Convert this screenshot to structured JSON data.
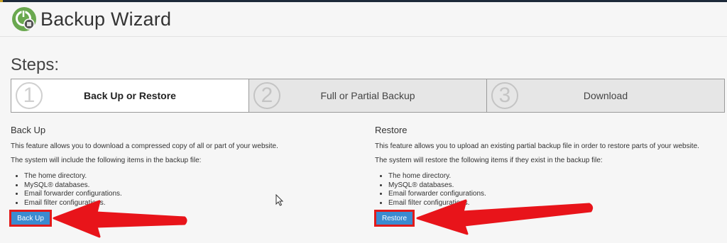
{
  "header": {
    "title": "Backup Wizard",
    "logo_icon": "backup-wizard-logo-icon"
  },
  "steps": {
    "title": "Steps:",
    "items": [
      {
        "number": "1",
        "label": "Back Up or Restore",
        "active": true
      },
      {
        "number": "2",
        "label": "Full or Partial Backup",
        "active": false
      },
      {
        "number": "3",
        "label": "Download",
        "active": false
      }
    ]
  },
  "backup": {
    "heading": "Back Up",
    "description": "This feature allows you to download a compressed copy of all or part of your website.",
    "list_intro": "The system will include the following items in the backup file:",
    "items": [
      "The home directory.",
      "MySQL® databases.",
      "Email forwarder configurations.",
      "Email filter configurations."
    ],
    "button_label": "Back Up"
  },
  "restore": {
    "heading": "Restore",
    "description": "This feature allows you to upload an existing partial backup file in order to restore parts of your website.",
    "list_intro": "The system will restore the following items if they exist in the backup file:",
    "items": [
      "The home directory.",
      "MySQL® databases.",
      "Email forwarder configurations.",
      "Email filter configurations."
    ],
    "button_label": "Restore"
  },
  "colors": {
    "accent": "#3b8bd0",
    "annotation": "#e21a1a",
    "logo_green": "#6aa84f"
  }
}
